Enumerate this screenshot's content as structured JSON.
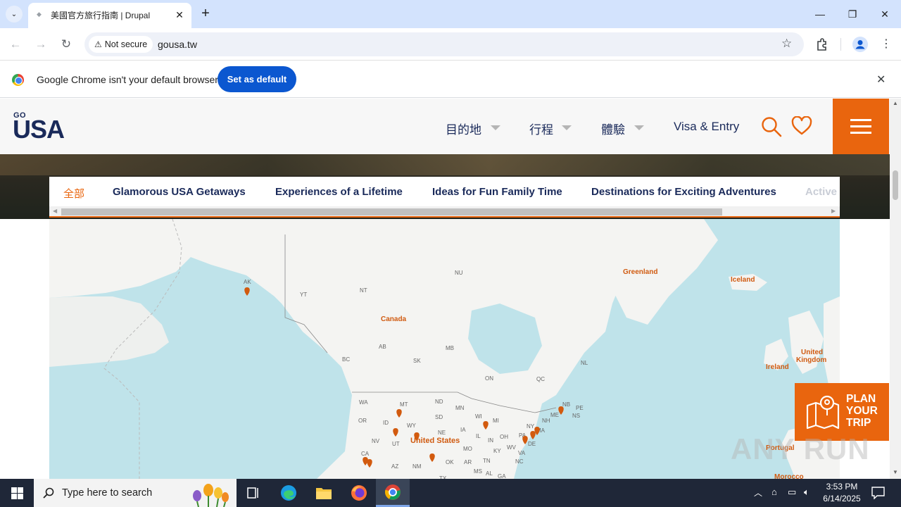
{
  "browser": {
    "tab_title": "美國官方旅行指南 | Drupal",
    "security_label": "Not secure",
    "url": "gousa.tw",
    "infobar_text": "Google Chrome isn't your default browser",
    "infobar_button": "Set as default"
  },
  "site": {
    "logo_top": "GO",
    "logo_main": "USA",
    "nav": [
      "目的地",
      "行程",
      "體驗",
      "Visa & Entry"
    ],
    "filters": [
      "全部",
      "Glamorous USA Getaways",
      "Experiences of a Lifetime",
      "Ideas for Fun Family Time",
      "Destinations for Exciting Adventures",
      "Active"
    ],
    "plan_trip": [
      "PLAN",
      "YOUR",
      "TRIP"
    ]
  },
  "map": {
    "countries": {
      "canada": "Canada",
      "usa": "United States",
      "greenland": "Greenland",
      "iceland": "Iceland",
      "ireland": "Ireland",
      "uk_line1": "United",
      "uk_line2": "Kingdom",
      "portugal": "Portugal",
      "morocco": "Morocco"
    },
    "regions": [
      "AK",
      "YT",
      "NT",
      "NU",
      "BC",
      "AB",
      "SK",
      "MB",
      "ON",
      "QC",
      "NL",
      "NB",
      "PE",
      "NS",
      "WA",
      "OR",
      "CA",
      "NV",
      "ID",
      "MT",
      "WY",
      "UT",
      "AZ",
      "NM",
      "ND",
      "SD",
      "NE",
      "MN",
      "IA",
      "WI",
      "MI",
      "IL",
      "IN",
      "OH",
      "KY",
      "WV",
      "VA",
      "NC",
      "TN",
      "MO",
      "OK",
      "AR",
      "MS",
      "AL",
      "GA",
      "PA",
      "NY",
      "ME",
      "NH",
      "MA",
      "DE",
      "TX"
    ]
  },
  "taskbar": {
    "search_placeholder": "Type here to search",
    "time": "3:53 PM",
    "date": "6/14/2025"
  },
  "watermark": "ANY RUN",
  "colors": {
    "brand_orange": "#e9650e",
    "brand_navy": "#1a2a5a",
    "chrome_blue": "#0b57d0"
  }
}
